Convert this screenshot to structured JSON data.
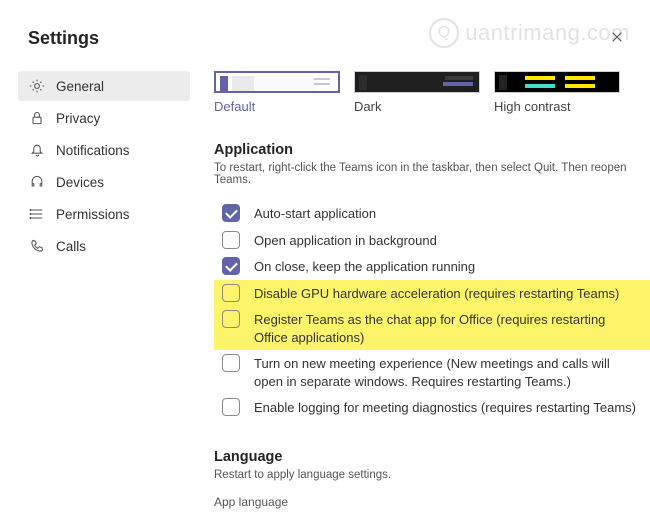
{
  "title": "Settings",
  "watermark": "uantrimang.com",
  "sidebar": {
    "items": [
      {
        "label": "General",
        "icon": "gear-icon",
        "active": true
      },
      {
        "label": "Privacy",
        "icon": "lock-icon",
        "active": false
      },
      {
        "label": "Notifications",
        "icon": "bell-icon",
        "active": false
      },
      {
        "label": "Devices",
        "icon": "headset-icon",
        "active": false
      },
      {
        "label": "Permissions",
        "icon": "list-icon",
        "active": false
      },
      {
        "label": "Calls",
        "icon": "phone-icon",
        "active": false
      }
    ]
  },
  "themes": [
    {
      "label": "Default",
      "selected": true,
      "kind": "default"
    },
    {
      "label": "Dark",
      "selected": false,
      "kind": "dark"
    },
    {
      "label": "High contrast",
      "selected": false,
      "kind": "high"
    }
  ],
  "application": {
    "heading": "Application",
    "subtext": "To restart, right-click the Teams icon in the taskbar, then select Quit. Then reopen Teams.",
    "options": [
      {
        "label": "Auto-start application",
        "checked": true,
        "highlight": false
      },
      {
        "label": "Open application in background",
        "checked": false,
        "highlight": false
      },
      {
        "label": "On close, keep the application running",
        "checked": true,
        "highlight": false
      },
      {
        "label": "Disable GPU hardware acceleration (requires restarting Teams)",
        "checked": false,
        "highlight": true
      },
      {
        "label": "Register Teams as the chat app for Office (requires restarting Office applications)",
        "checked": false,
        "highlight": true
      },
      {
        "label": "Turn on new meeting experience (New meetings and calls will open in separate windows. Requires restarting Teams.)",
        "checked": false,
        "highlight": false
      },
      {
        "label": "Enable logging for meeting diagnostics (requires restarting Teams)",
        "checked": false,
        "highlight": false
      }
    ]
  },
  "language": {
    "heading": "Language",
    "subtext": "Restart to apply language settings.",
    "field": "App language"
  }
}
